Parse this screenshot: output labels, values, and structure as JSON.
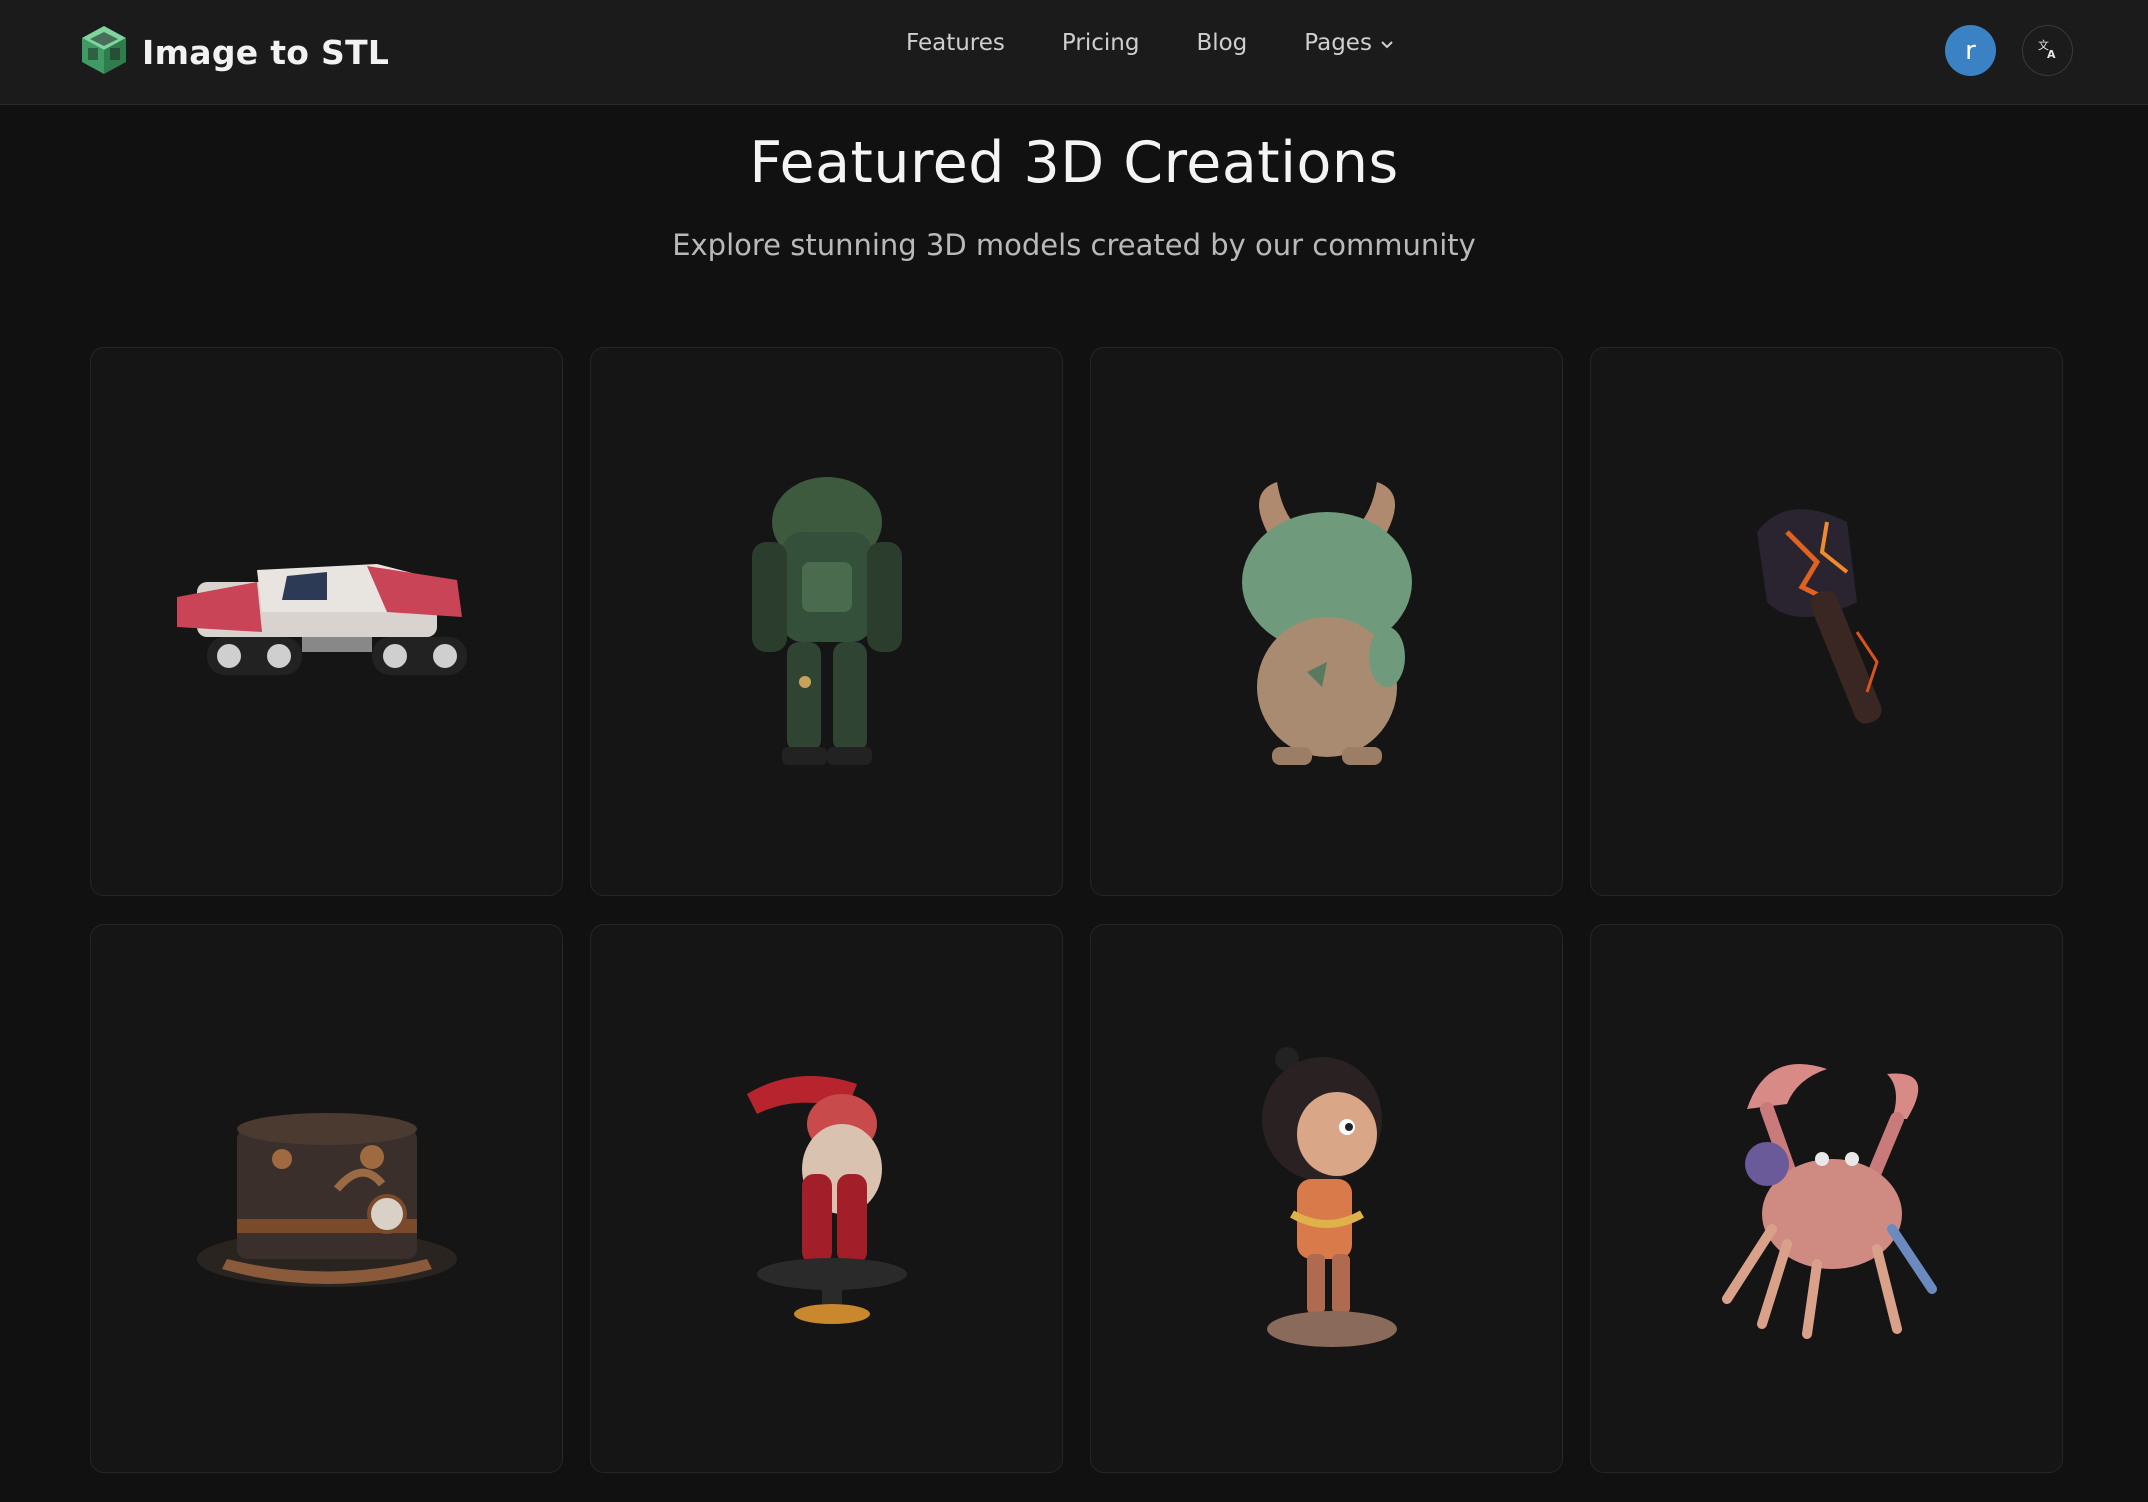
{
  "brand": {
    "name": "Image to STL",
    "logo_icon": "cube-logo-icon",
    "accent": "#4fb37a"
  },
  "nav": {
    "links": [
      {
        "label": "Features"
      },
      {
        "label": "Pricing"
      },
      {
        "label": "Blog"
      },
      {
        "label": "Pages",
        "icon": "chevron-down-icon"
      }
    ]
  },
  "user": {
    "avatar_letter": "r",
    "avatar_color": "#3b82c4"
  },
  "language": {
    "icon": "translate-icon"
  },
  "hero": {
    "title": "Featured 3D Creations",
    "subtitle": "Explore stunning 3D models created by our community"
  },
  "gallery": {
    "items": [
      {
        "subject": "red-white-tracked-vehicle"
      },
      {
        "subject": "green-armored-robot"
      },
      {
        "subject": "green-horned-creature"
      },
      {
        "subject": "lava-battle-axe"
      },
      {
        "subject": "steampunk-top-hat"
      },
      {
        "subject": "red-breakdancer-figure"
      },
      {
        "subject": "chibi-girl-figure"
      },
      {
        "subject": "pastel-crab"
      }
    ]
  }
}
